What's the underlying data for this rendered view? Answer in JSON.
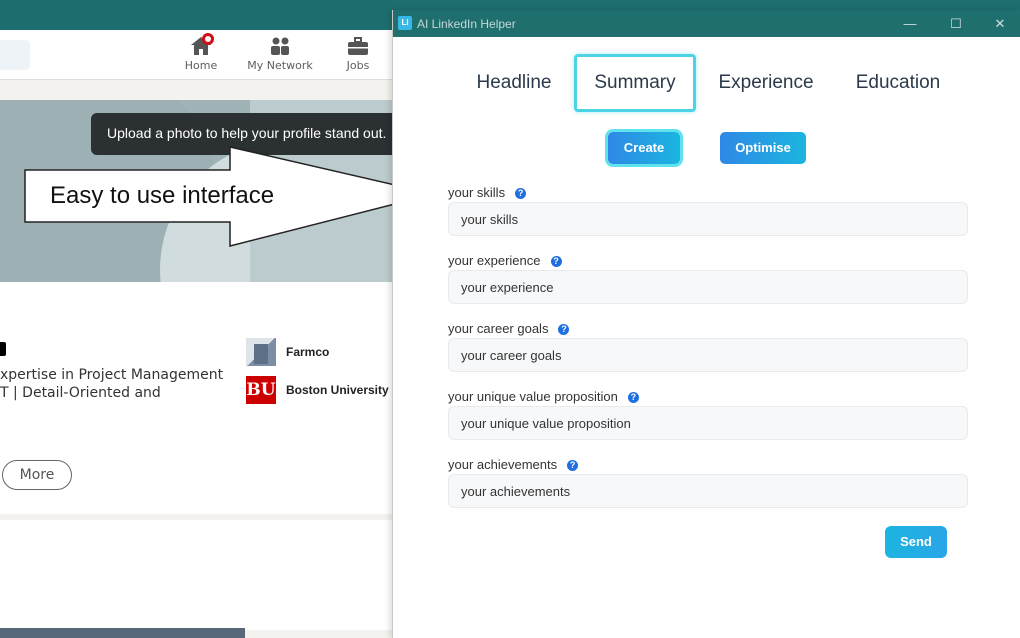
{
  "background_app": {
    "nav": [
      {
        "label": "Home",
        "icon": "home-icon"
      },
      {
        "label": "My Network",
        "icon": "network-icon"
      },
      {
        "label": "Jobs",
        "icon": "briefcase-icon"
      }
    ],
    "tooltip": "Upload a photo to help your profile stand out.",
    "profile_lines": [
      "xpertise in Project Management",
      "T | Detail-Oriented and"
    ],
    "companies": [
      "Farmco",
      "Boston University"
    ],
    "bu_logo_text": "BU",
    "more_label": "More"
  },
  "annotation": {
    "text": "Easy to use interface"
  },
  "helper": {
    "title": "AI LinkedIn Helper",
    "icon_text": "LI",
    "window_controls": {
      "minimize": "—",
      "maximize": "☐",
      "close": "✕"
    },
    "tabs": [
      {
        "label": "Headline",
        "active": false
      },
      {
        "label": "Summary",
        "active": true
      },
      {
        "label": "Experience",
        "active": false
      },
      {
        "label": "Education",
        "active": false
      }
    ],
    "actions": {
      "create": "Create",
      "optimise": "Optimise"
    },
    "fields": [
      {
        "label": "your skills",
        "placeholder": "your skills"
      },
      {
        "label": "your experience",
        "placeholder": "your experience"
      },
      {
        "label": "your career goals",
        "placeholder": "your career goals"
      },
      {
        "label": "your unique value proposition",
        "placeholder": "your unique value proposition"
      },
      {
        "label": "your achievements",
        "placeholder": "your achievements"
      }
    ],
    "send_label": "Send",
    "help_glyph": "?"
  },
  "colors": {
    "titlebar": "#1f6f6f",
    "accent_gradient_start": "#2f88e6",
    "accent_gradient_end": "#1cb5e0",
    "active_tab_border": "#4dd3e6"
  }
}
